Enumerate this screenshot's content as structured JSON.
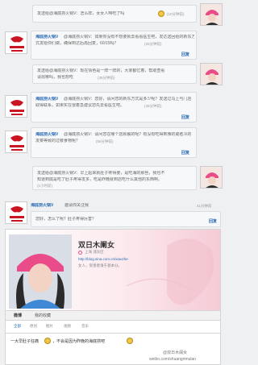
{
  "posts": [
    {
      "line1": "发送给@海底捞火锅V：怎么样，女女人啊吃了吗",
      "time": "(10分钟前)"
    },
    {
      "line1": "@海底捞火锅V：如果你没有不想要就去看看医生吧，发达送回给的新东方",
      "line2": "式发给你们做，确保到达后再回复，60/15吗？",
      "time": "(25分钟前)",
      "reply": "回复"
    },
    {
      "line1": "发送给@海底捞火锅V：现在情色是一阵一阵的，大家都忆着，帮助查看",
      "line2": "请找哪吗，我也想吃",
      "time": "(35分钟前)"
    },
    {
      "line1": "@海底捞火锅V：您好，请问您的新东方式是多少呢？发送过马上与门店",
      "line2": "取得联系，如果实在很着急建议您先去看医生吧。",
      "time": "(45分钟前)",
      "reply": "回复"
    },
    {
      "line1": "@海底捞火锅V：请问您在哪个店就餐的呢？有没有吃得到辣的或者冷的",
      "line2": "发菜等致的过敏食物呢？",
      "time": "(55分钟前)",
      "reply": "回复"
    },
    {
      "line1": "发送给@海底捞火锅V：早上起来就肚子疼得要，是吃海的那些，我也不",
      "line2": "知道到底是吃了肚子疼得发多，吃是昨晚就到店吃什么其他的东西啊。",
      "time": "(1小时前)"
    },
    {
      "header_text": "邀请你关注我",
      "header_time": "41分钟前",
      "line1": "您好，怎么了呢？肚子疼得厉害？",
      "reply": "回复"
    }
  ],
  "brand_name": "海底捞火锅V",
  "profile": {
    "name": "双日木阑女",
    "location": "上海 浦东区",
    "url": "http://blog.sina.com.cn/xiaozhe",
    "bio": "女人，受患者请于基本分。"
  },
  "tabs": [
    "微博",
    "我的收藏"
  ],
  "subtabs": [
    "全部",
    "原创",
    "图片",
    "视频",
    "音乐"
  ],
  "bottom_text": "一大早肚子狂痛",
  "bottom_text2": "，不会是因为昨晚的海底捞吧",
  "watermark1": "@双日木阑女",
  "watermark2": "weibo.com/shuangrimulan",
  "colors": {
    "link": "#2a6bb5",
    "brand_red": "#c91622",
    "pink_cap": "#e94c89"
  }
}
